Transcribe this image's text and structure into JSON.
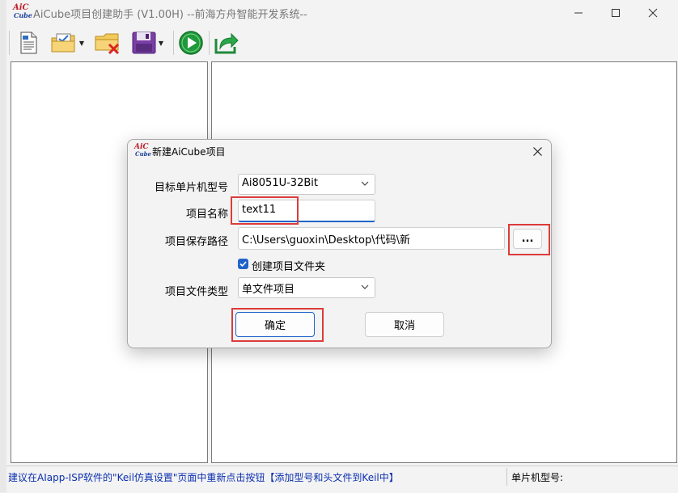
{
  "app": {
    "title": "AiCube项目创建助手 (V1.00H) --前海方舟智能开发系统--",
    "logo_text_top": "AiC",
    "logo_text_bottom": "Cube"
  },
  "toolbar": {
    "items": [
      "new-file-icon",
      "open-folder-icon",
      "delete-folder-icon",
      "save-icon",
      "run-icon",
      "export-icon"
    ]
  },
  "dialog": {
    "title": "新建AiCube项目",
    "mcu_label": "目标单片机型号",
    "mcu_value": "Ai8051U-32Bit",
    "name_label": "项目名称",
    "name_value": "text11",
    "path_label": "项目保存路径",
    "path_value": "C:\\Users\\guoxin\\Desktop\\代码\\新",
    "browse_label": "...",
    "create_folder_label": "创建项目文件夹",
    "create_folder_checked": true,
    "type_label": "项目文件类型",
    "type_value": "单文件项目",
    "ok_label": "确定",
    "cancel_label": "取消"
  },
  "status": {
    "message": "建议在AIapp-ISP软件的\"Keil仿真设置\"页面中重新点击按钮【添加型号和头文件到Keil中】",
    "mcu_model_label": "单片机型号:"
  },
  "colors": {
    "highlight": "#dd3b3b",
    "status_text": "#0b2fb0",
    "checkbox": "#1f63c9"
  }
}
